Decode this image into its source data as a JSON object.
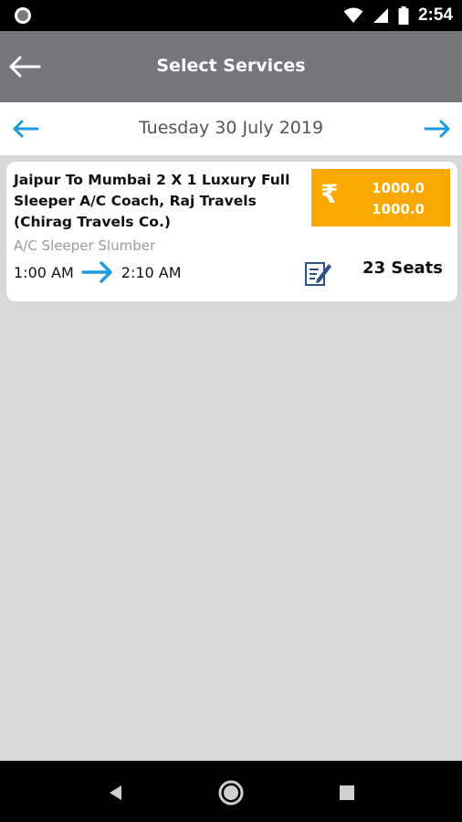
{
  "status_bar": {
    "time": "2:54",
    "icons": [
      "notification-dot-icon",
      "wifi-icon",
      "signal-icon",
      "battery-icon"
    ]
  },
  "app_bar": {
    "title": "Select Services",
    "back_icon": "arrow-left-icon"
  },
  "date_bar": {
    "date": "Tuesday 30 July 2019",
    "prev_icon": "arrow-left-icon",
    "next_icon": "arrow-right-icon"
  },
  "services": [
    {
      "name": "Jaipur To Mumbai 2 X 1 Luxury Full Sleeper A/C Coach, Raj Travels (Chirag Travels Co.)",
      "bus_type": "A/C  Sleeper Slumber",
      "departure": "1:00 AM",
      "arrival": "2:10 AM",
      "currency_symbol": "₹",
      "fares": [
        "1000.0",
        "1000.0"
      ],
      "seats": "23 Seats"
    }
  ],
  "nav_bar": {
    "icons": [
      "back-triangle-icon",
      "home-circle-icon",
      "recents-square-icon"
    ]
  },
  "colors": {
    "app_bar": "#77777b",
    "accent": "#1e9be0",
    "fare_bg": "#f9a800",
    "background": "#d8d8d8"
  }
}
